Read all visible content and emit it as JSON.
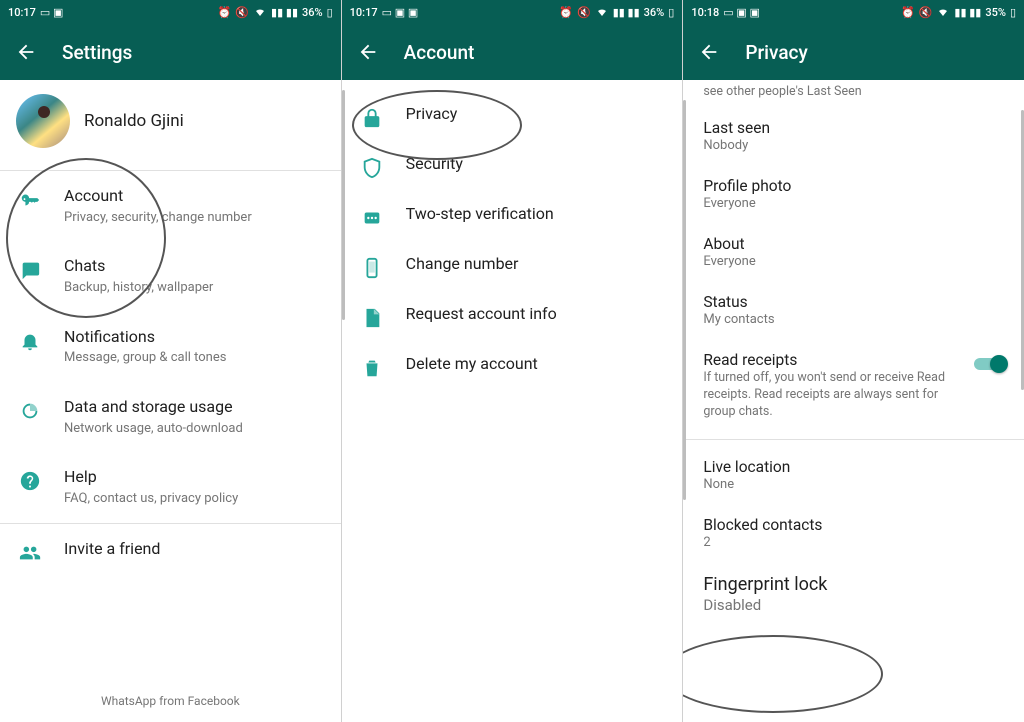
{
  "screens": {
    "settings": {
      "statusbar": {
        "time": "10:17",
        "battery": "36%"
      },
      "title": "Settings",
      "profile_name": "Ronaldo Gjini",
      "items": [
        {
          "title": "Account",
          "sub": "Privacy, security, change number",
          "icon": "key"
        },
        {
          "title": "Chats",
          "sub": "Backup, history, wallpaper",
          "icon": "chat"
        },
        {
          "title": "Notifications",
          "sub": "Message, group & call tones",
          "icon": "bell"
        },
        {
          "title": "Data and storage usage",
          "sub": "Network usage, auto-download",
          "icon": "data"
        },
        {
          "title": "Help",
          "sub": "FAQ, contact us, privacy policy",
          "icon": "help"
        },
        {
          "title": "Invite a friend",
          "sub": "",
          "icon": "people"
        }
      ],
      "footer": "WhatsApp from Facebook"
    },
    "account": {
      "statusbar": {
        "time": "10:17",
        "battery": "36%"
      },
      "title": "Account",
      "items": [
        {
          "title": "Privacy",
          "icon": "lock"
        },
        {
          "title": "Security",
          "icon": "shield"
        },
        {
          "title": "Two-step verification",
          "icon": "twostep"
        },
        {
          "title": "Change number",
          "icon": "phone"
        },
        {
          "title": "Request account info",
          "icon": "doc"
        },
        {
          "title": "Delete my account",
          "icon": "trash"
        }
      ]
    },
    "privacy": {
      "statusbar": {
        "time": "10:18",
        "battery": "35%"
      },
      "title": "Privacy",
      "top_note": "see other people's Last Seen",
      "items": [
        {
          "title": "Last seen",
          "sub": "Nobody"
        },
        {
          "title": "Profile photo",
          "sub": "Everyone"
        },
        {
          "title": "About",
          "sub": "Everyone"
        },
        {
          "title": "Status",
          "sub": "My contacts"
        }
      ],
      "read_receipts": {
        "title": "Read receipts",
        "sub": "If turned off, you won't send or receive Read receipts. Read receipts are always sent for group chats.",
        "on": true
      },
      "bottom_items": [
        {
          "title": "Live location",
          "sub": "None"
        },
        {
          "title": "Blocked contacts",
          "sub": "2"
        },
        {
          "title": "Fingerprint lock",
          "sub": "Disabled"
        }
      ]
    }
  },
  "highlight_labels": {
    "settings_account": "Account item highlighted",
    "account_privacy": "Privacy item highlighted",
    "privacy_fingerprint": "Fingerprint lock highlighted"
  }
}
